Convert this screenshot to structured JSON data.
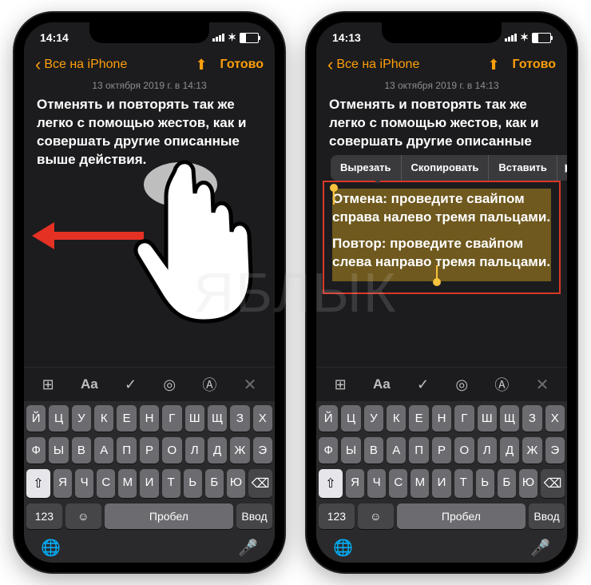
{
  "watermark": "ЯБЛЫК",
  "left": {
    "time": "14:14",
    "back_label": "Все на iPhone",
    "done": "Готово",
    "timestamp": "13 октября 2019 г. в 14:13",
    "title_text": "Отменять и повторять так же легко с помощью жестов, как и совершать другие описанные выше действия."
  },
  "right": {
    "time": "14:13",
    "back_label": "Все на iPhone",
    "done": "Готово",
    "timestamp": "13 октября 2019 г. в 14:13",
    "title_text": "Отменять и повторять так же легко с помощью жестов, как и совершать другие описанные",
    "ctx_cut": "Вырезать",
    "ctx_copy": "Скопировать",
    "ctx_paste": "Вставить",
    "ctx_more": "▶",
    "sel_p1": "Отмена: проведите свайпом справа налево тремя пальцами.",
    "sel_p2": "Повтор: проведите свайпом слева направо тремя пальцами."
  },
  "toolbar": {
    "table": "⊞",
    "aa": "Aa",
    "check": "✓",
    "camera": "◎",
    "pen": "Ⓐ",
    "close": "✕"
  },
  "keyboard": {
    "row1": [
      "Й",
      "Ц",
      "У",
      "К",
      "Е",
      "Н",
      "Г",
      "Ш",
      "Щ",
      "З",
      "Х"
    ],
    "row2": [
      "Ф",
      "Ы",
      "В",
      "А",
      "П",
      "Р",
      "О",
      "Л",
      "Д",
      "Ж",
      "Э"
    ],
    "row3_shift": "⇧",
    "row3": [
      "Я",
      "Ч",
      "С",
      "М",
      "И",
      "Т",
      "Ь",
      "Б",
      "Ю"
    ],
    "row3_del": "⌫",
    "num": "123",
    "emoji": "☺",
    "space": "Пробел",
    "enter": "Ввод",
    "globe": "🌐",
    "mic": "🎤"
  }
}
